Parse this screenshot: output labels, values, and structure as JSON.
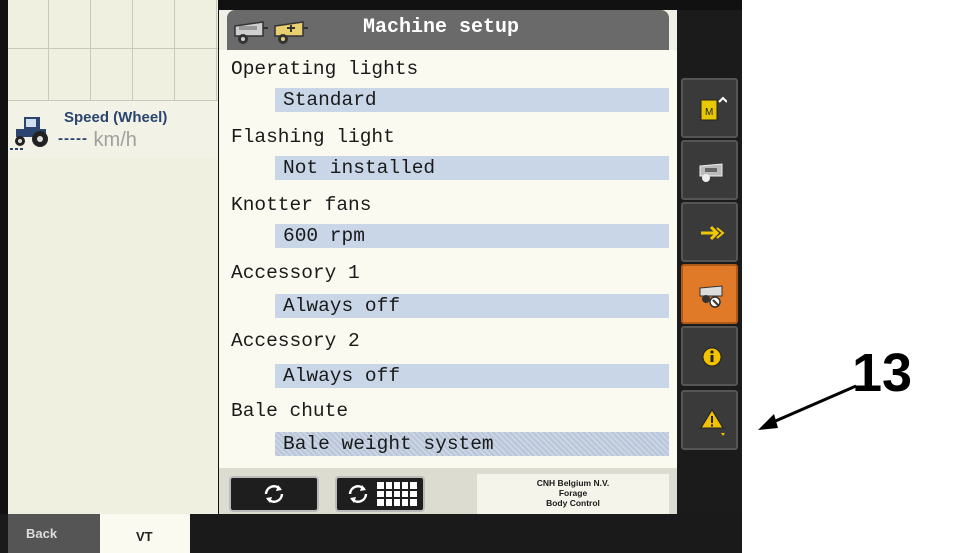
{
  "title": "Machine setup",
  "left": {
    "speed_title": "Speed (Wheel)",
    "speed_value": "-----",
    "speed_unit": "km/h"
  },
  "settings": [
    {
      "label": "Operating lights",
      "value": "Standard"
    },
    {
      "label": "Flashing light",
      "value": "Not installed"
    },
    {
      "label": "Knotter fans",
      "value": "600 rpm"
    },
    {
      "label": "Accessory 1",
      "value": "Always off"
    },
    {
      "label": "Accessory 2",
      "value": "Always off"
    },
    {
      "label": "Bale chute",
      "value": "Bale weight system"
    }
  ],
  "company": {
    "line1": "CNH Belgium N.V.",
    "line2": "Forage",
    "line3": "Body Control"
  },
  "tabs": {
    "back": "Back",
    "vt": "VT"
  },
  "callout": "13",
  "colors": {
    "title_bar": "#6a6a6a",
    "value_highlight": "#c8d6e8",
    "active_softkey": "#e07a28",
    "info_icon": "#f2c200",
    "warning_icon": "#f2c200"
  },
  "softkeys": [
    "memory-icon",
    "machine-icon",
    "enter-arrow-icon",
    "machine-settings-icon",
    "info-icon",
    "warning-icon"
  ]
}
